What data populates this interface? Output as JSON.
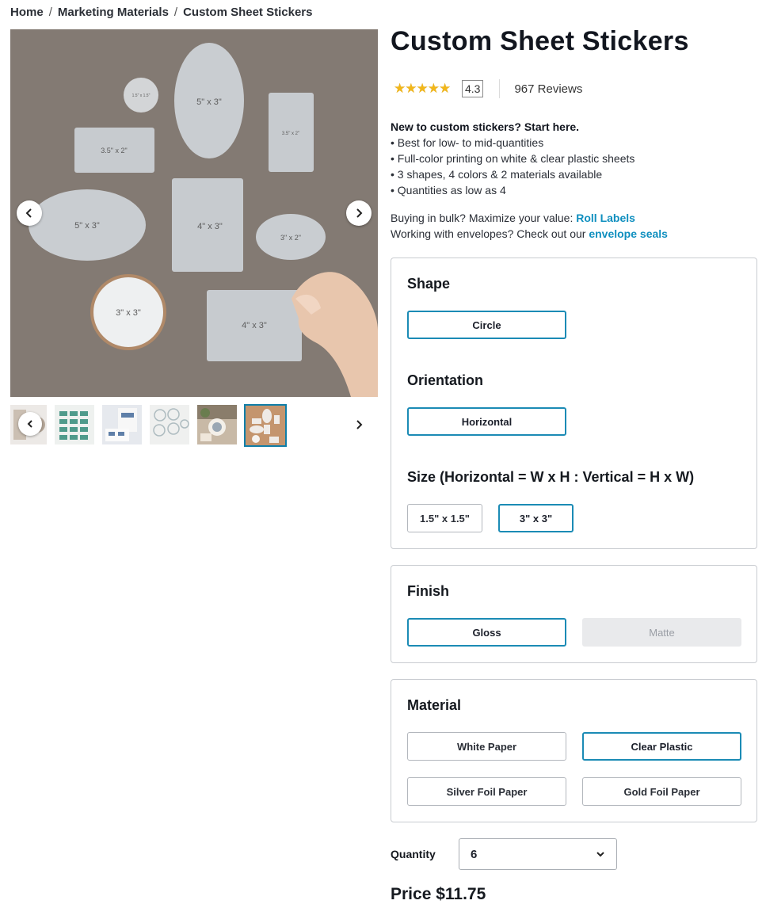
{
  "breadcrumb": {
    "home": "Home",
    "sep1": "/",
    "category": "Marketing Materials",
    "sep2": "/",
    "current": "Custom Sheet Stickers"
  },
  "gallery": {
    "sticker_labels": [
      "1.5\" x 1.5\"",
      "5\" x 3\"",
      "3.5\" x 2\"",
      "3.5\" x 2\"",
      "5\" x 3\"",
      "4\" x 3\"",
      "3\" x 2\"",
      "3\" x 3\"",
      "4\" x 3\""
    ],
    "thumbnail_count": 6,
    "selected_thumbnail": 6,
    "prev_icon": "chevron-left-icon",
    "next_icon": "chevron-right-icon"
  },
  "product": {
    "title": "Custom Sheet Stickers",
    "rating": 4.3,
    "rating_max": 5,
    "rating_text": "4.3",
    "reviews": "967 Reviews",
    "stars_glyph": "★★★★★",
    "intro_heading": "New to custom stickers? Start here.",
    "bullets": [
      "• Best for low- to mid-quantities",
      "• Full-color printing on white & clear plastic sheets",
      "• 3 shapes, 4 colors & 2 materials available",
      "• Quantities as low as 4"
    ],
    "upsell1_text": "Buying in bulk? Maximize your value: ",
    "upsell1_link": "Roll Labels",
    "upsell2_text": "Working with envelopes? Check out our ",
    "upsell2_link": "envelope seals"
  },
  "options": {
    "shape_title": "Shape",
    "shape_selected": "Circle",
    "orientation_title": "Orientation",
    "orientation_selected": "Horizontal",
    "size_title": "Size (Horizontal = W x H : Vertical = H x W)",
    "sizes": [
      "1.5\" x 1.5\"",
      "3\" x 3\""
    ],
    "size_selected": "3\" x 3\"",
    "finish_title": "Finish",
    "finish_options": [
      "Gloss",
      "Matte"
    ],
    "finish_selected": "Gloss",
    "finish_disabled": "Matte",
    "material_title": "Material",
    "materials": [
      "White Paper",
      "Clear Plastic",
      "Silver Foil Paper",
      "Gold Foil Paper"
    ],
    "material_selected": "Clear Plastic"
  },
  "quantity": {
    "label": "Quantity",
    "value": "6",
    "icon": "chevron-down-icon"
  },
  "price": {
    "text": "Price $11.75"
  },
  "colors": {
    "accent": "#1b8bb5",
    "link": "#0f8fbf",
    "star": "#f2b71b",
    "hero_bg": "#837a73"
  }
}
